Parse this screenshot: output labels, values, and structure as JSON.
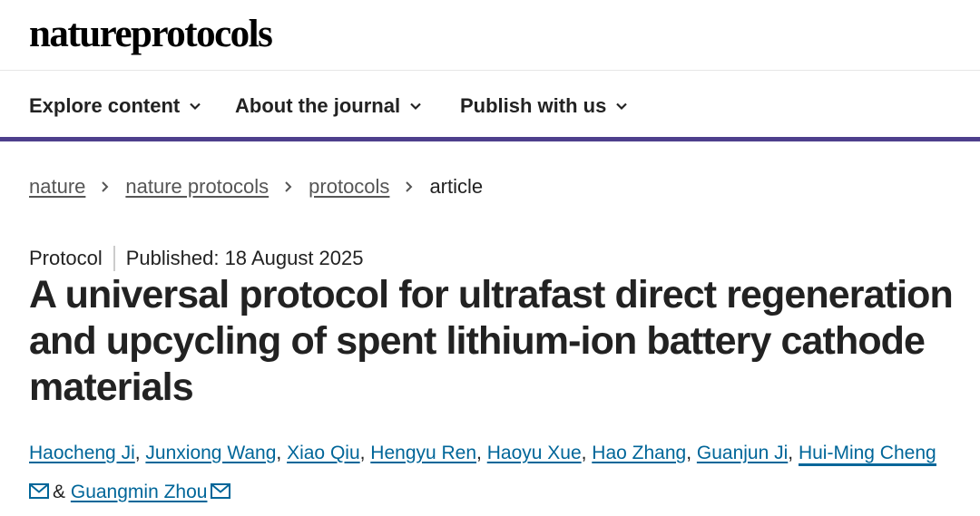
{
  "header": {
    "logo": "natureprotocols"
  },
  "nav": {
    "items": [
      {
        "label": "Explore content"
      },
      {
        "label": "About the journal"
      },
      {
        "label": "Publish with us"
      }
    ]
  },
  "breadcrumb": {
    "links": [
      "nature",
      "nature protocols",
      "protocols"
    ],
    "current": "article"
  },
  "article": {
    "type": "Protocol",
    "published": "Published: 18 August 2025",
    "title": "A universal protocol for ultrafast direct regeneration and upcycling of spent lithium-ion battery cathode materials",
    "authors": [
      "Haocheng Ji",
      "Junxiong Wang",
      "Xiao Qiu",
      "Hengyu Ren",
      "Haoyu Xue",
      "Hao Zhang",
      "Guanjun Ji",
      "Hui-Ming Cheng",
      "Guangmin Zhou"
    ],
    "separator": ", ",
    "ampersand": "&"
  },
  "colors": {
    "accent": "#4d3f8c",
    "link": "#006699",
    "text": "#222222"
  },
  "icons": {
    "nav": "chevron-down-icon",
    "breadcrumb": "chevron-right-icon",
    "contact": "mail-icon"
  }
}
